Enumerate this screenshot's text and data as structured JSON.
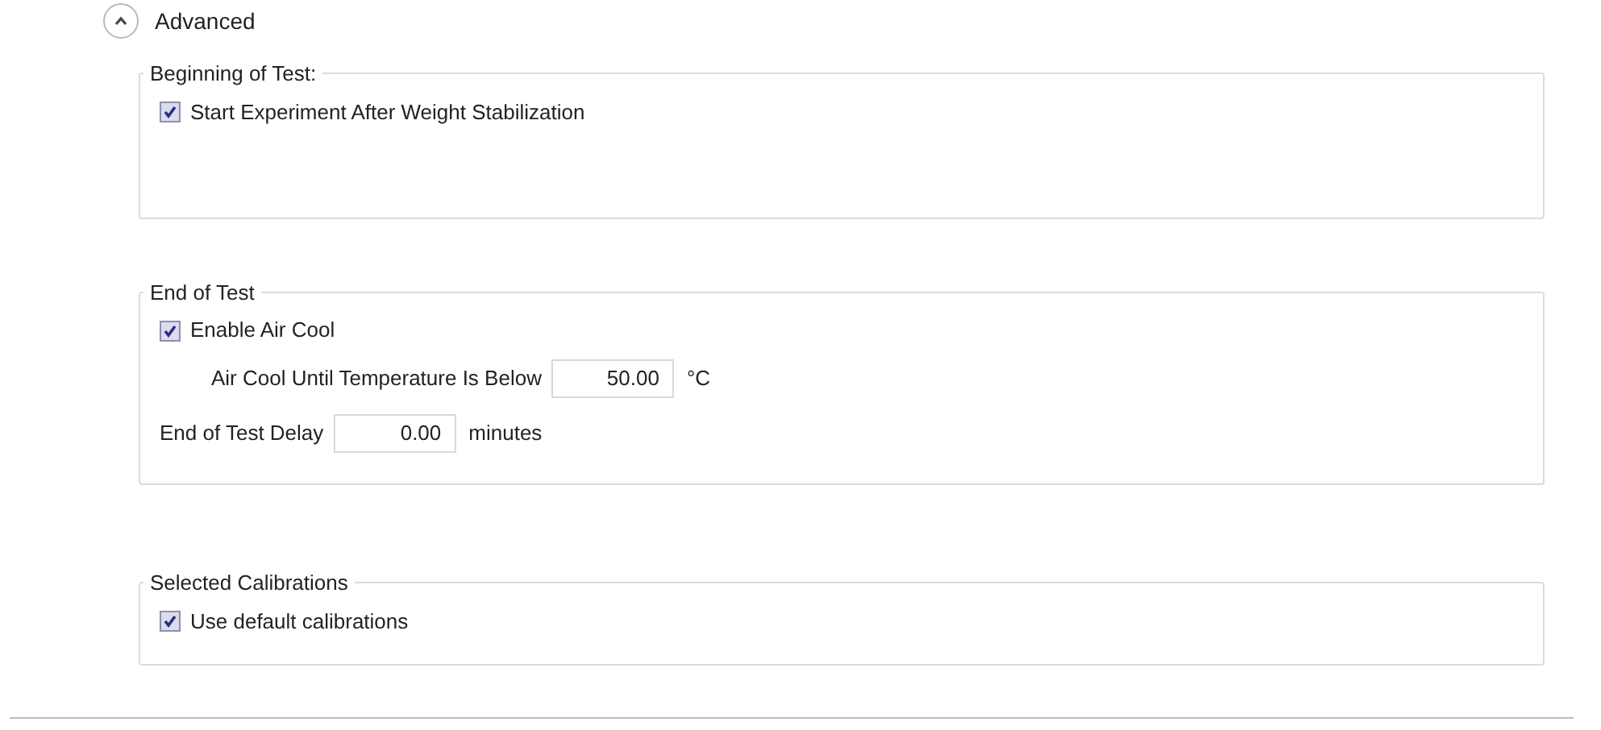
{
  "advanced": {
    "label": "Advanced",
    "expanded": true
  },
  "groups": [
    {
      "title": "Beginning of Test:",
      "items": [
        {
          "kind": "checkbox",
          "label": "Start Experiment After Weight Stabilization",
          "checked": true
        }
      ]
    },
    {
      "title": "End of Test",
      "items": [
        {
          "kind": "checkbox",
          "label": "Enable Air Cool",
          "checked": true
        },
        {
          "kind": "number",
          "indented": true,
          "label": "Air Cool Until Temperature Is Below",
          "value": "50.00",
          "unit": "°C"
        },
        {
          "kind": "number",
          "indented": false,
          "label": "End of Test Delay",
          "value": "0.00",
          "unit": "minutes"
        }
      ]
    },
    {
      "title": "Selected Calibrations",
      "items": [
        {
          "kind": "checkbox",
          "label": "Use default calibrations",
          "checked": true
        }
      ]
    }
  ]
}
